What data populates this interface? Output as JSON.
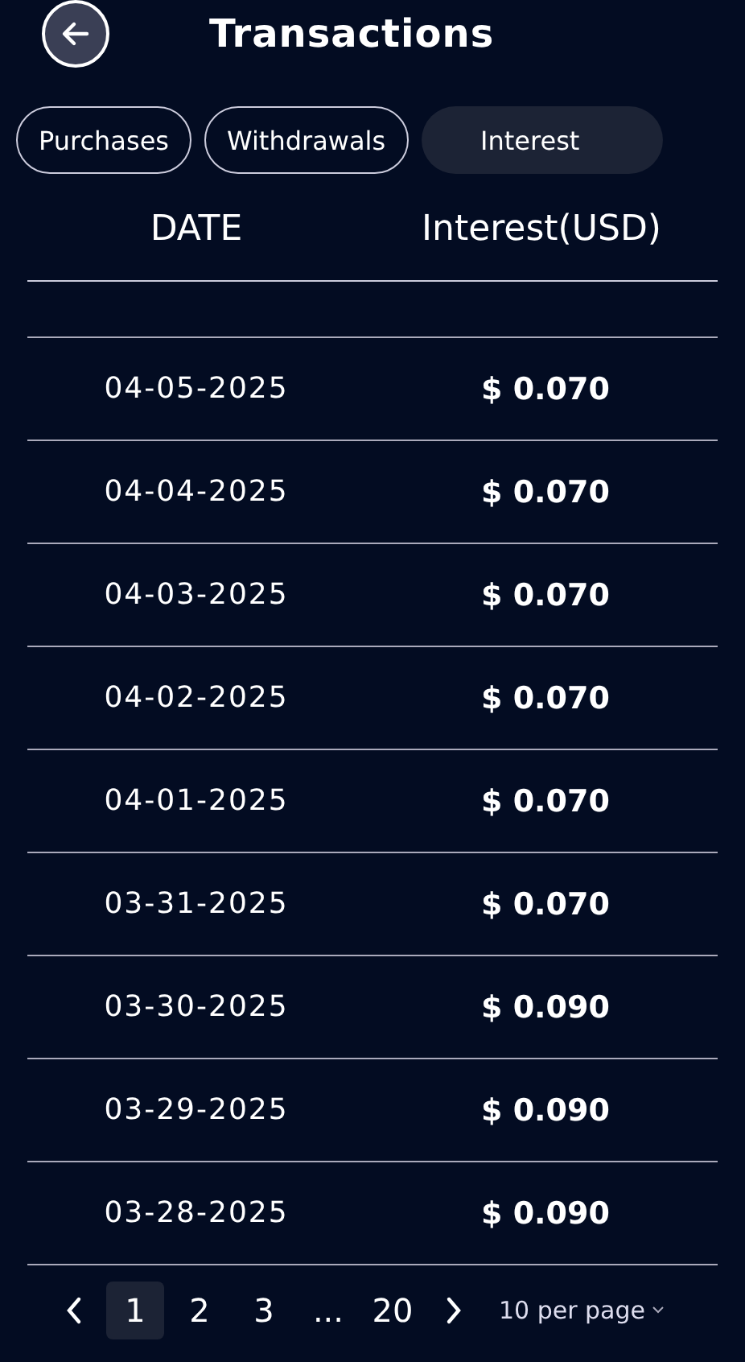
{
  "header": {
    "title": "Transactions"
  },
  "tabs": [
    {
      "label": "Purchases",
      "selected": false
    },
    {
      "label": "Withdrawals",
      "selected": false
    },
    {
      "label": "Interest",
      "selected": true
    }
  ],
  "table": {
    "columns": [
      "DATE",
      "Interest(USD)"
    ],
    "rows": [
      {
        "date": "04-05-2025",
        "amount": "$ 0.070"
      },
      {
        "date": "04-04-2025",
        "amount": "$ 0.070"
      },
      {
        "date": "04-03-2025",
        "amount": "$ 0.070"
      },
      {
        "date": "04-02-2025",
        "amount": "$ 0.070"
      },
      {
        "date": "04-01-2025",
        "amount": "$ 0.070"
      },
      {
        "date": "03-31-2025",
        "amount": "$ 0.070"
      },
      {
        "date": "03-30-2025",
        "amount": "$ 0.090"
      },
      {
        "date": "03-29-2025",
        "amount": "$ 0.090"
      },
      {
        "date": "03-28-2025",
        "amount": "$ 0.090"
      }
    ]
  },
  "pagination": {
    "pages": [
      {
        "label": "1",
        "selected": true
      },
      {
        "label": "2",
        "selected": false
      },
      {
        "label": "3",
        "selected": false
      },
      {
        "label": "...",
        "selected": false
      },
      {
        "label": "20",
        "selected": false
      }
    ],
    "per_page": "10 per page"
  }
}
